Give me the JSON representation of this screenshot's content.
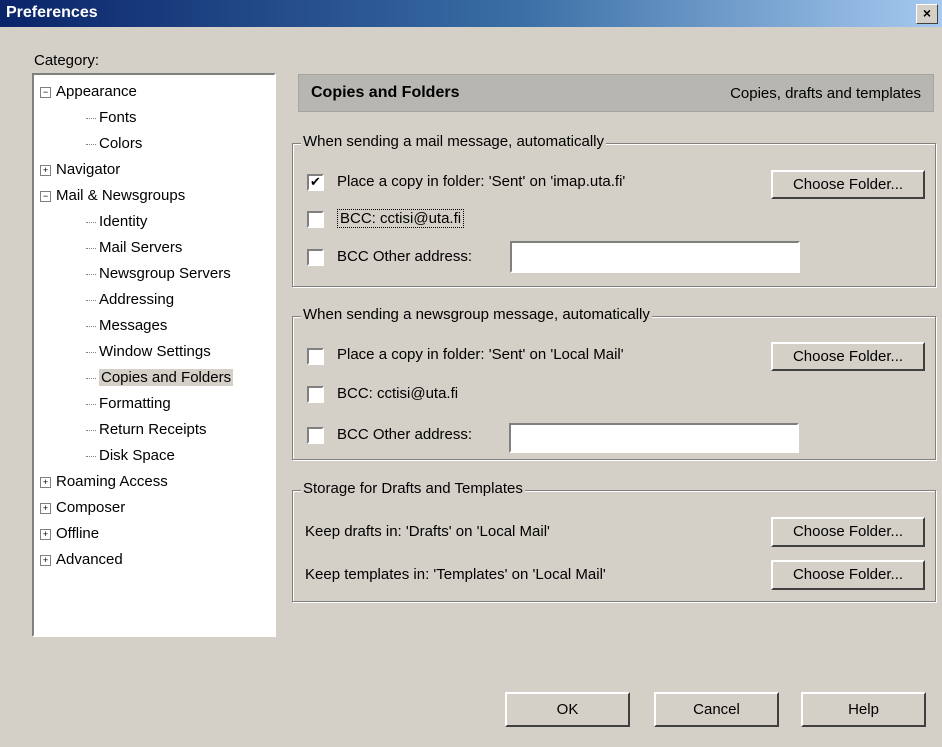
{
  "window": {
    "title": "Preferences",
    "close_glyph": "×"
  },
  "category_label": "Category:",
  "tree": [
    "Appearance",
    "Fonts",
    "Colors",
    "Navigator",
    "Mail & Newsgroups",
    "Identity",
    "Mail Servers",
    "Newsgroup Servers",
    "Addressing",
    "Messages",
    "Window Settings",
    "Copies and Folders",
    "Formatting",
    "Return Receipts",
    "Disk Space",
    "Roaming Access",
    "Composer",
    "Offline",
    "Advanced"
  ],
  "header": {
    "title": "Copies and Folders",
    "subtitle": "Copies, drafts and templates"
  },
  "mail_group": {
    "legend": "When sending a mail message, automatically",
    "place_copy_label": "Place a copy in folder: 'Sent' on 'imap.uta.fi'",
    "place_copy_checked": true,
    "bcc_label": "BCC:  cctisi@uta.fi",
    "bcc_checked": false,
    "bcc_other_label": "BCC Other address:",
    "bcc_other_checked": false,
    "bcc_other_value": "",
    "choose_folder": "Choose Folder..."
  },
  "news_group": {
    "legend": "When sending a newsgroup message, automatically",
    "place_copy_label": "Place a copy in folder: 'Sent' on 'Local Mail'",
    "place_copy_checked": false,
    "bcc_label": "BCC:  cctisi@uta.fi",
    "bcc_checked": false,
    "bcc_other_label": "BCC Other address:",
    "bcc_other_checked": false,
    "bcc_other_value": "",
    "choose_folder": "Choose Folder..."
  },
  "storage_group": {
    "legend": "Storage for Drafts and Templates",
    "drafts_label": "Keep drafts in: 'Drafts' on 'Local Mail'",
    "templates_label": "Keep templates in: 'Templates' on 'Local Mail'",
    "choose_folder": "Choose Folder..."
  },
  "buttons": {
    "ok": "OK",
    "cancel": "Cancel",
    "help": "Help"
  }
}
